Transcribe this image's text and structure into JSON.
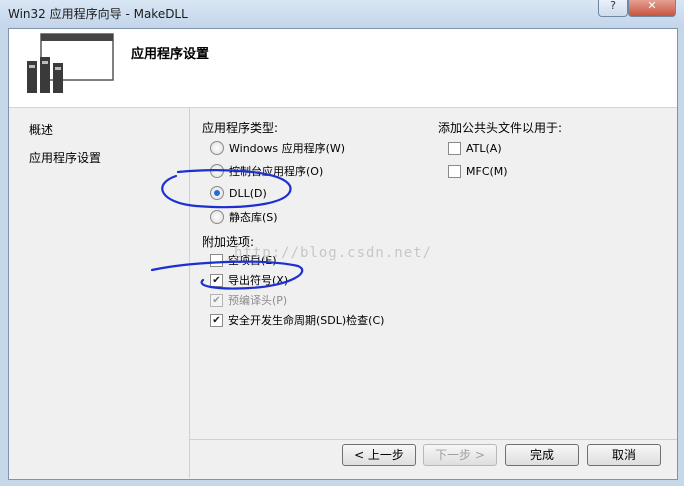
{
  "window": {
    "title": "Win32 应用程序向导 - MakeDLL",
    "help_label": "?",
    "close_label": "✕"
  },
  "header": {
    "title": "应用程序设置"
  },
  "nav": {
    "items": [
      {
        "label": "概述"
      },
      {
        "label": "应用程序设置"
      }
    ]
  },
  "app_type": {
    "title": "应用程序类型:",
    "options": [
      {
        "label": "Windows 应用程序(W)",
        "checked": false
      },
      {
        "label": "控制台应用程序(O)",
        "checked": false
      },
      {
        "label": "DLL(D)",
        "checked": true
      },
      {
        "label": "静态库(S)",
        "checked": false
      }
    ]
  },
  "additional": {
    "title": "附加选项:",
    "options": [
      {
        "label": "空项目(E)",
        "checked": false,
        "disabled": false
      },
      {
        "label": "导出符号(X)",
        "checked": true,
        "disabled": false
      },
      {
        "label": "预编译头(P)",
        "checked": true,
        "disabled": true
      },
      {
        "label": "安全开发生命周期(SDL)检查(C)",
        "checked": true,
        "disabled": false
      }
    ]
  },
  "headers_for": {
    "title": "添加公共头文件以用于:",
    "options": [
      {
        "label": "ATL(A)",
        "checked": false
      },
      {
        "label": "MFC(M)",
        "checked": false
      }
    ]
  },
  "watermark": "http://blog.csdn.net/",
  "buttons": {
    "prev": "< 上一步",
    "next": "下一步 >",
    "finish": "完成",
    "cancel": "取消"
  },
  "colors": {
    "annotation_ink": "#1c2fd0",
    "radio_selected": "#1f6fd6"
  }
}
